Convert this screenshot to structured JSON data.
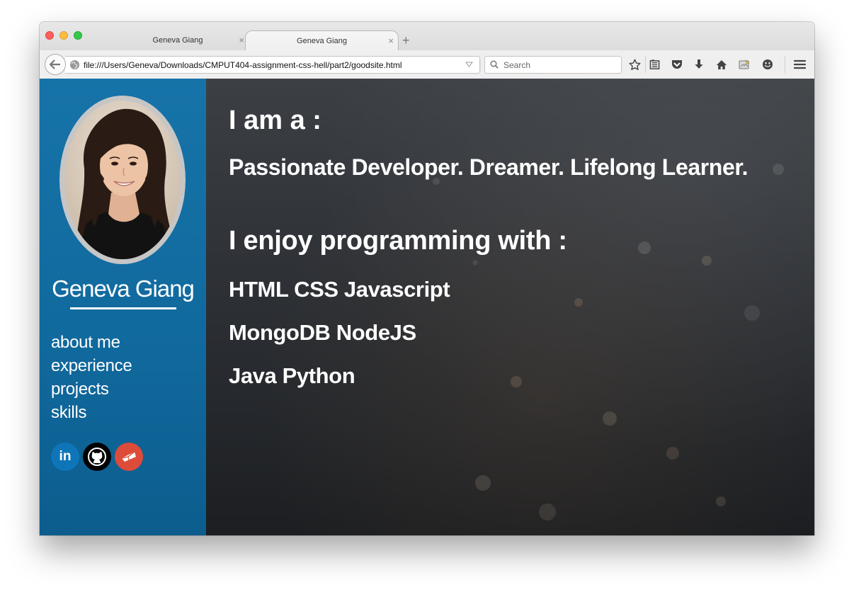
{
  "browser": {
    "tabs": [
      {
        "title": "Geneva Giang",
        "active": false
      },
      {
        "title": "Geneva Giang",
        "active": true
      }
    ],
    "url": "file:///Users/Geneva/Downloads/CMPUT404-assignment-css-hell/part2/goodsite.html",
    "search_placeholder": "Search",
    "tab_close_glyph": "×",
    "new_tab_glyph": "+"
  },
  "sidebar": {
    "name": "Geneva Giang",
    "nav": [
      {
        "label": "about me"
      },
      {
        "label": "experience"
      },
      {
        "label": "projects"
      },
      {
        "label": "skills"
      }
    ],
    "socials": [
      {
        "icon": "linkedin-icon",
        "label": "in",
        "color": "#0e76b8"
      },
      {
        "icon": "github-icon",
        "color": "#000000"
      },
      {
        "icon": "mail-icon",
        "color": "#dd4b39"
      }
    ],
    "colors": {
      "background": "#1673a8"
    }
  },
  "main": {
    "iam_heading": "I am a :",
    "tagline": "Passionate Developer. Dreamer. Lifelong Learner.",
    "enjoy_heading": "I enjoy programming with :",
    "languages": [
      "HTML CSS Javascript",
      "MongoDB NodeJS",
      "Java Python"
    ]
  }
}
